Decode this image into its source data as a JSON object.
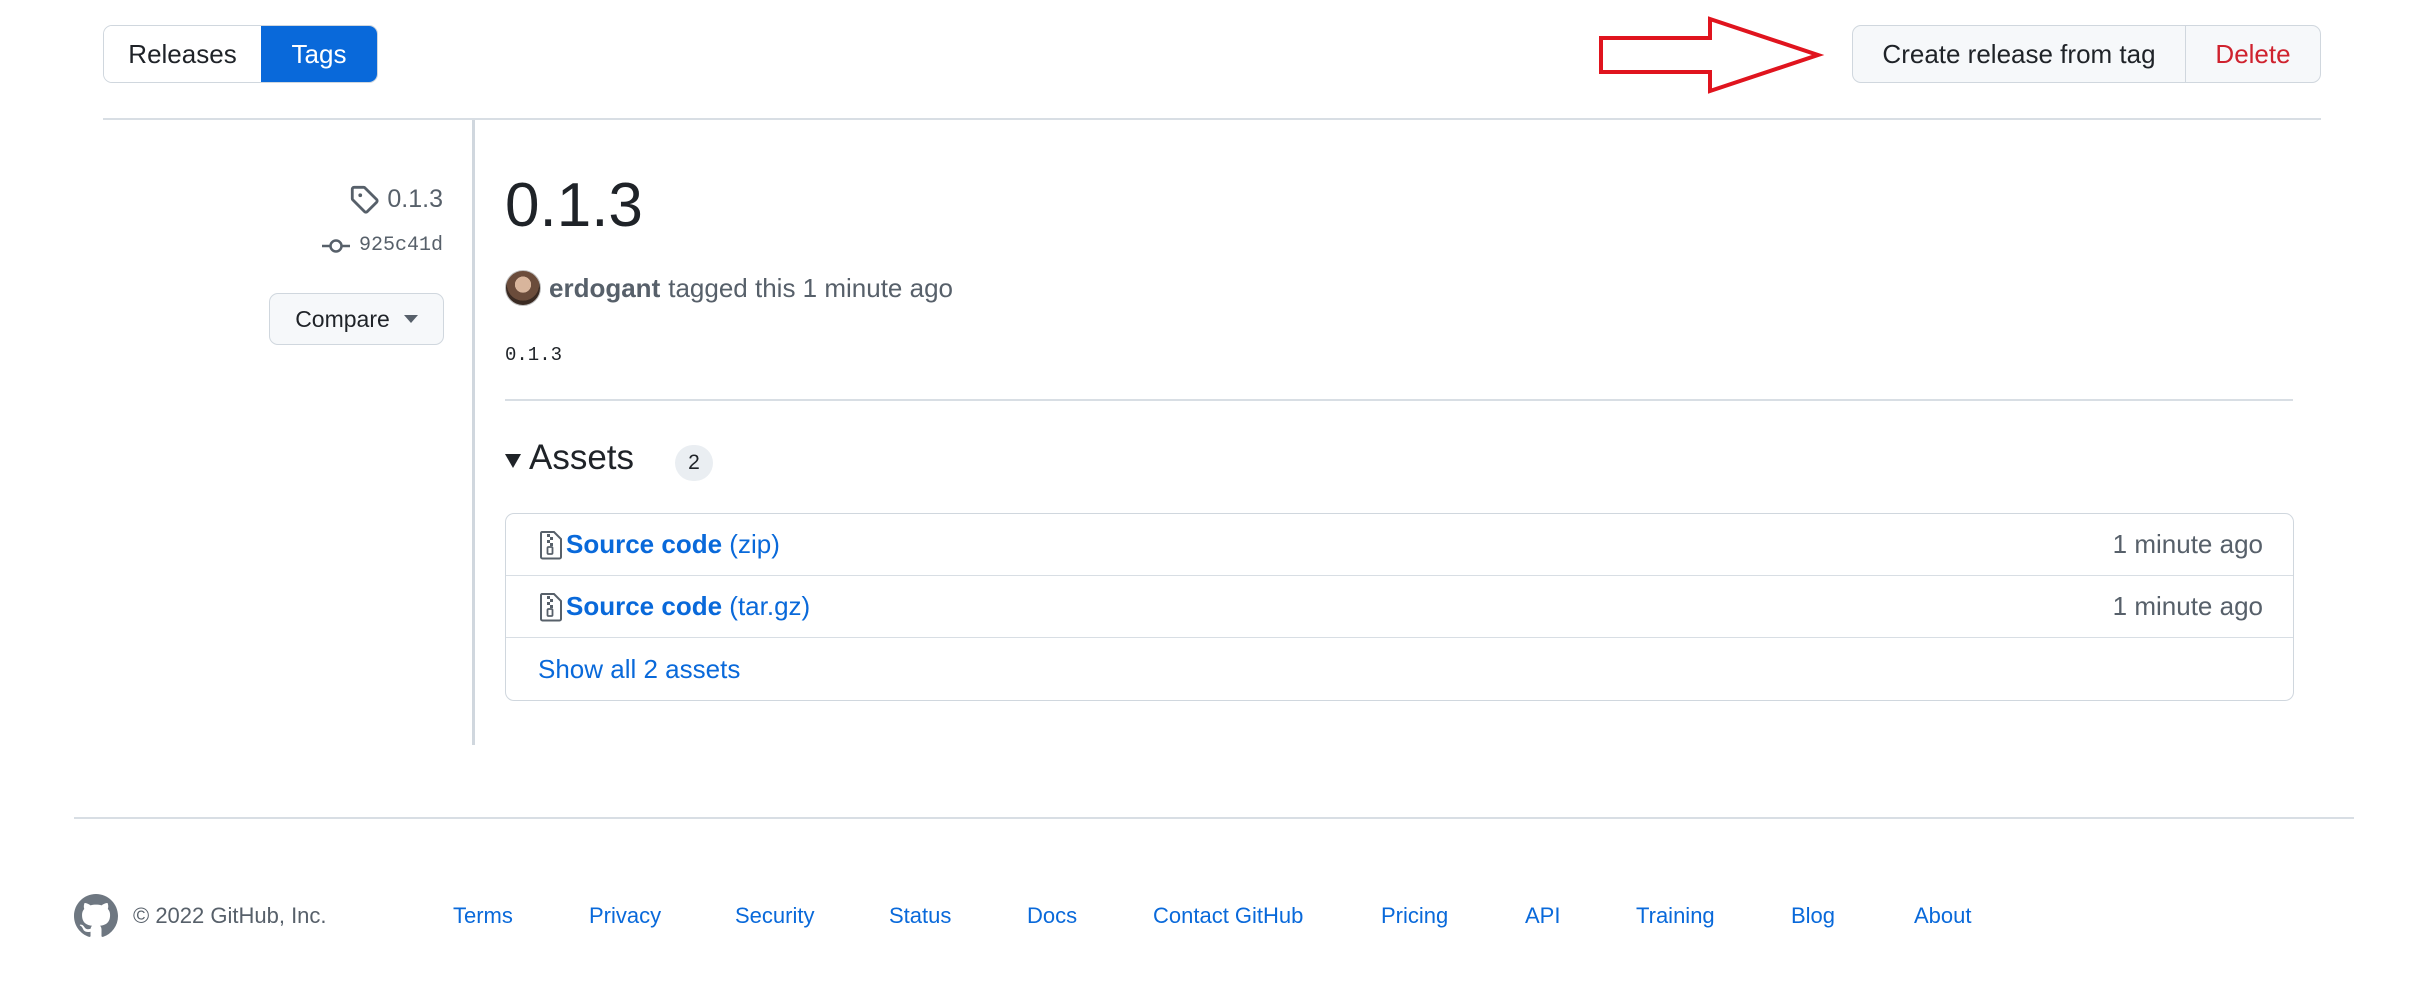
{
  "tabs": {
    "releases": "Releases",
    "tags": "Tags"
  },
  "actions": {
    "create_release": "Create release from tag",
    "delete": "Delete"
  },
  "sidebar": {
    "tag_name": "0.1.3",
    "commit_sha": "925c41d",
    "compare_label": "Compare"
  },
  "release": {
    "title": "0.1.3",
    "author": "erdogant",
    "tagged_text": "tagged this 1 minute ago",
    "body": "0.1.3"
  },
  "assets": {
    "heading": "Assets",
    "count": "2",
    "items": [
      {
        "name": "Source code",
        "ext": "(zip)",
        "time": "1 minute ago"
      },
      {
        "name": "Source code",
        "ext": "(tar.gz)",
        "time": "1 minute ago"
      }
    ],
    "show_all": "Show all 2 assets"
  },
  "footer": {
    "copyright": "© 2022 GitHub, Inc.",
    "links": [
      "Terms",
      "Privacy",
      "Security",
      "Status",
      "Docs",
      "Contact GitHub",
      "Pricing",
      "API",
      "Training",
      "Blog",
      "About"
    ]
  },
  "colors": {
    "accent": "#0969da",
    "danger": "#cf222e",
    "arrow": "#e0141e"
  },
  "icons": {
    "tag": "tag-icon",
    "commit": "git-commit-icon",
    "zip": "file-zip-icon",
    "logo": "github-logo"
  }
}
